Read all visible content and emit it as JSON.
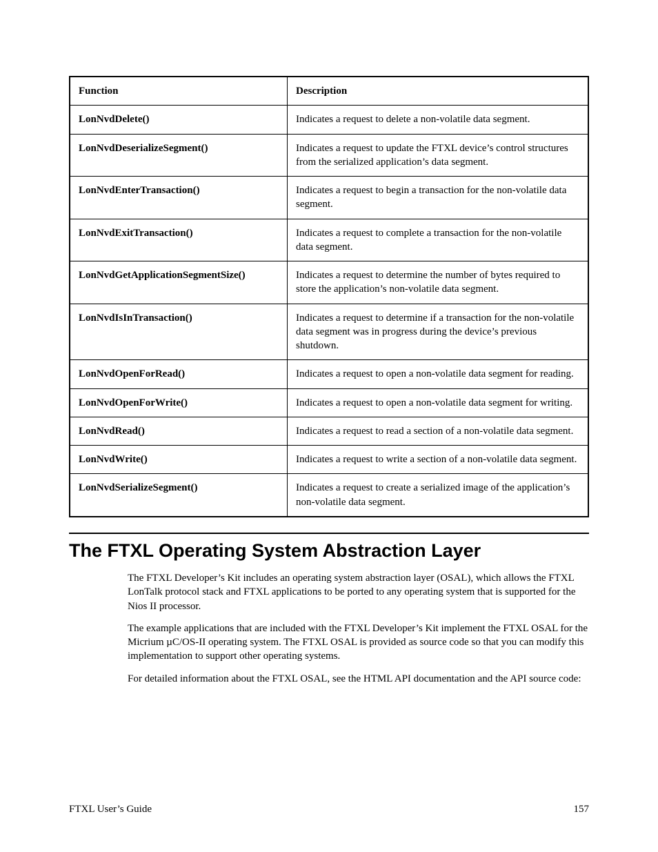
{
  "table": {
    "headers": {
      "col1": "Function",
      "col2": "Description"
    },
    "rows": [
      {
        "func": "LonNvdDelete()",
        "desc": "Indicates a request to delete a non-volatile data segment."
      },
      {
        "func": "LonNvdDeserializeSegment()",
        "desc": "Indicates a request to update the FTXL device’s control structures from the serialized application’s data segment."
      },
      {
        "func": "LonNvdEnterTransaction()",
        "desc": "Indicates a request to begin a transaction for the non-volatile data segment."
      },
      {
        "func": "LonNvdExitTransaction()",
        "desc": "Indicates a request to complete a transaction for the non-volatile data segment."
      },
      {
        "func": "LonNvdGetApplicationSegmentSize()",
        "desc": "Indicates a request to determine the number of bytes required to store the application’s non-volatile data segment."
      },
      {
        "func": "LonNvdIsInTransaction()",
        "desc": "Indicates a request to determine if a transaction for the non-volatile data segment was in progress during the device’s previous shutdown."
      },
      {
        "func": "LonNvdOpenForRead()",
        "desc": "Indicates a request to open a non-volatile data segment for reading."
      },
      {
        "func": "LonNvdOpenForWrite()",
        "desc": "Indicates a request to open a non-volatile data segment for writing."
      },
      {
        "func": "LonNvdRead()",
        "desc": "Indicates a request to read a section of a non-volatile data segment."
      },
      {
        "func": "LonNvdWrite()",
        "desc": "Indicates a request to write a section of a non-volatile data segment."
      },
      {
        "func": "LonNvdSerializeSegment()",
        "desc": "Indicates a request to create a serialized image of the application’s non-volatile data segment."
      }
    ]
  },
  "section_title": "The FTXL Operating System Abstraction Layer",
  "paragraphs": [
    "The FTXL Developer’s Kit includes an operating system abstraction layer (OSAL), which allows the FTXL LonTalk protocol stack and FTXL applications to be ported to any operating system that is supported for the Nios II processor.",
    "The example applications that are included with the FTXL Developer’s Kit implement the FTXL OSAL for the Micrium µC/OS-II operating system.  The FTXL OSAL is provided as source code so that you can modify this implementation to support other operating systems.",
    "For detailed information about the FTXL OSAL, see the HTML API documentation and the API source code:"
  ],
  "footer": {
    "left": "FTXL User’s Guide",
    "right": "157"
  }
}
